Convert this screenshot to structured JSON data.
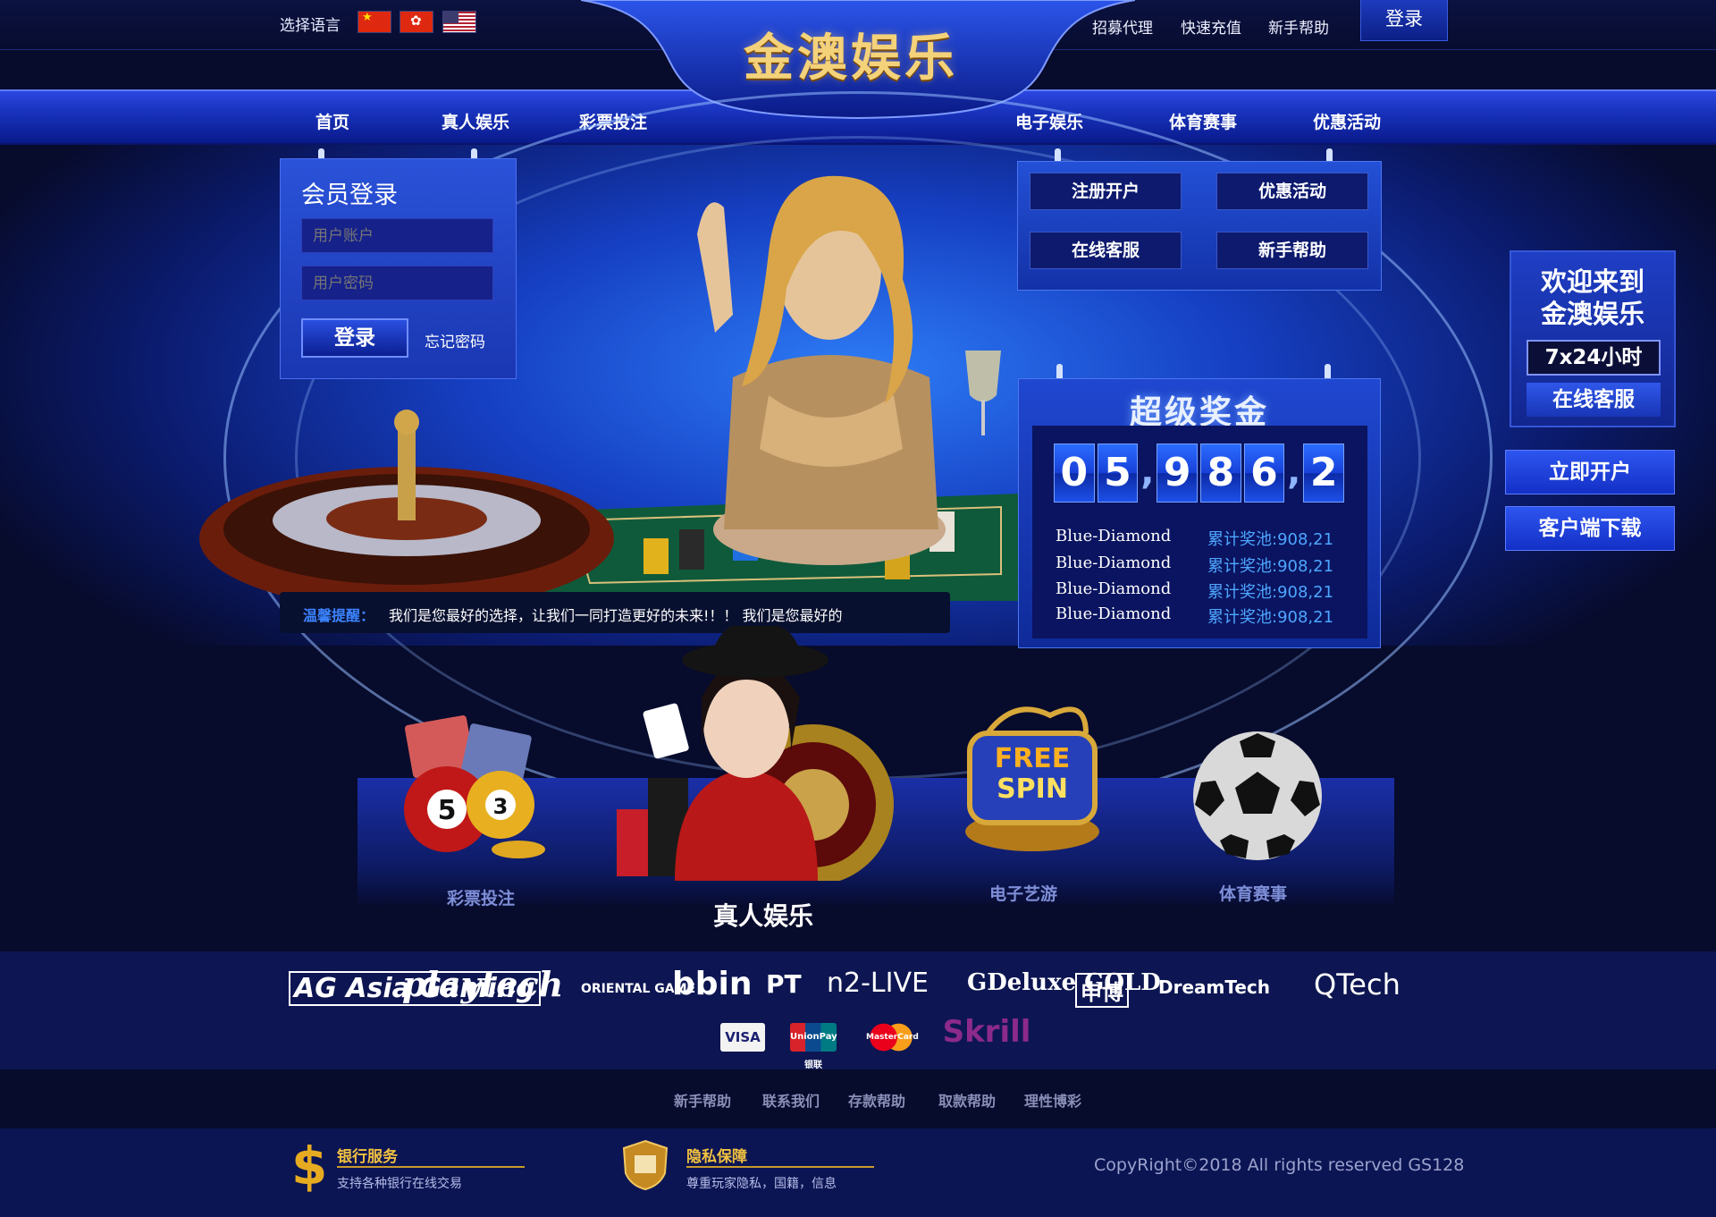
{
  "topbar": {
    "language_label": "选择语言",
    "flags": [
      "china-flag-icon",
      "hongkong-flag-icon",
      "usa-flag-icon"
    ],
    "links": [
      "招募代理",
      "快速充值",
      "新手帮助"
    ],
    "login_label": "登录"
  },
  "brand": {
    "logo_text": "金澳娱乐",
    "accent_gold": "#f4d27a",
    "primary_blue": "#1d3bc4"
  },
  "nav": {
    "items": [
      "首页",
      "真人娱乐",
      "彩票投注",
      "电子娱乐",
      "体育赛事",
      "优惠活动"
    ]
  },
  "login_panel": {
    "title": "会员登录",
    "username_placeholder": "用户账户",
    "password_placeholder": "用户密码",
    "submit_label": "登录",
    "forgot_label": "忘记密码"
  },
  "quick_actions": [
    "注册开户",
    "优惠活动",
    "在线客服",
    "新手帮助"
  ],
  "jackpot": {
    "title": "超级奖金",
    "counter": [
      "0",
      "5",
      ",",
      "9",
      "8",
      "6",
      ",",
      "2"
    ],
    "rows": [
      {
        "name": "Blue-Diamond",
        "pool": "累计奖池:908,21"
      },
      {
        "name": "Blue-Diamond",
        "pool": "累计奖池:908,21"
      },
      {
        "name": "Blue-Diamond",
        "pool": "累计奖池:908,21"
      },
      {
        "name": "Blue-Diamond",
        "pool": "累计奖池:908,21"
      }
    ]
  },
  "notice": {
    "label": "温馨提醒：",
    "text": "我们是您最好的选择，让我们一同打造更好的未来!！！ 我们是您最好的"
  },
  "side_float": {
    "welcome_line1": "欢迎来到",
    "welcome_line2": "金澳娱乐",
    "hours": "7x24小时",
    "service_label": "在线客服",
    "open_account_label": "立即开户",
    "download_label": "客户端下载"
  },
  "games": [
    {
      "label": "彩票投注",
      "icon": "lottery-icon",
      "active": false
    },
    {
      "label": "真人娱乐",
      "icon": "live-dealer-icon",
      "active": true
    },
    {
      "label": "电子艺游",
      "icon": "slot-machine-icon",
      "active": false
    },
    {
      "label": "体育赛事",
      "icon": "soccer-ball-icon",
      "active": false
    }
  ],
  "partners": {
    "providers": [
      "AG Asia Gaming",
      "playtech",
      "ORIENTAL GAME",
      "bbin",
      "PT",
      "n2-LIVE",
      "GDeluxe GOLD",
      "申博",
      "DreamTech",
      "QTech"
    ],
    "payments": [
      "VISA",
      "UnionPay 银联",
      "MasterCard",
      "Skrill"
    ]
  },
  "footer_links": [
    "新手帮助",
    "联系我们",
    "存款帮助",
    "取款帮助",
    "理性博彩"
  ],
  "footer": {
    "bank_title": "银行服务",
    "bank_sub": "支持各种银行在线交易",
    "privacy_title": "隐私保障",
    "privacy_sub": "尊重玩家隐私，国籍，信息",
    "copyright": "CopyRight©2018 All rights reserved GS128"
  }
}
